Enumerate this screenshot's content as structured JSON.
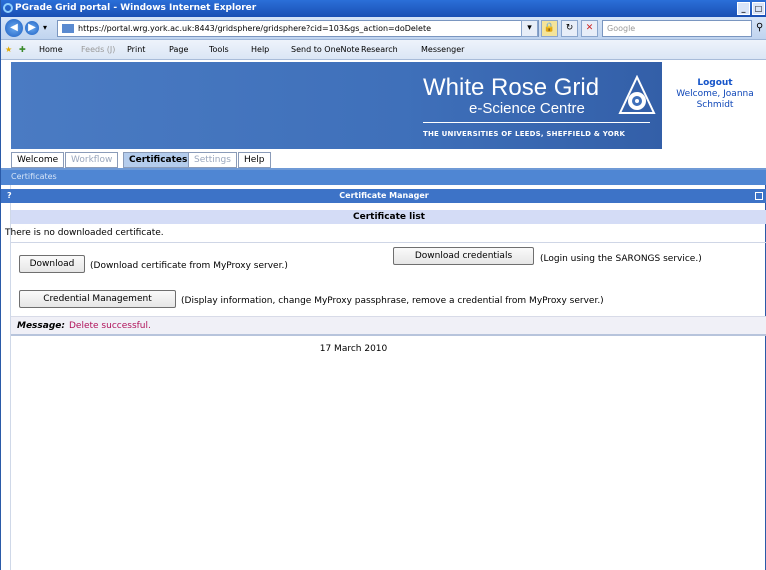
{
  "window": {
    "title": "PGrade Grid portal - Windows Internet Explorer"
  },
  "browser": {
    "url": "https://portal.wrg.york.ac.uk:8443/gridsphere/gridsphere?cid=103&gs_action=doDelete",
    "search_placeholder": "Google",
    "favorites_bar": [
      "Home",
      "Feeds (J)",
      "Print",
      "Page",
      "Tools",
      "Help",
      "Send to OneNote",
      "Research",
      "Messenger"
    ]
  },
  "banner": {
    "title": "White Rose Grid",
    "subtitle": "e-Science Centre",
    "universities": "THE UNIVERSITIES OF LEEDS, SHEFFIELD & YORK",
    "logout_label": "Logout",
    "welcome_text": "Welcome, Joanna Schmidt"
  },
  "tabs": [
    {
      "label": "Welcome",
      "state": "normal"
    },
    {
      "label": "Workflow",
      "state": "dim"
    },
    {
      "label": "Certificates",
      "state": "active"
    },
    {
      "label": "Settings",
      "state": "dim"
    },
    {
      "label": "Help",
      "state": "normal"
    }
  ],
  "breadcrumb": "Certificates",
  "portlet": {
    "help_mark": "?",
    "title": "Certificate Manager",
    "list_header": "Certificate list",
    "empty_text": "There is no downloaded certificate.",
    "download_button": "Download",
    "download_desc": "(Download certificate from MyProxy server.)",
    "download_credentials_button": "Download credentials",
    "download_credentials_desc": "(Login using the SARONGS service.)",
    "credential_management_button": "Credential Management",
    "credential_management_desc": "(Display information, change MyProxy passphrase, remove a credential from MyProxy server.)",
    "message_label": "Message:",
    "message_text": "Delete successful."
  },
  "footer": {
    "date": "17 March 2010"
  }
}
